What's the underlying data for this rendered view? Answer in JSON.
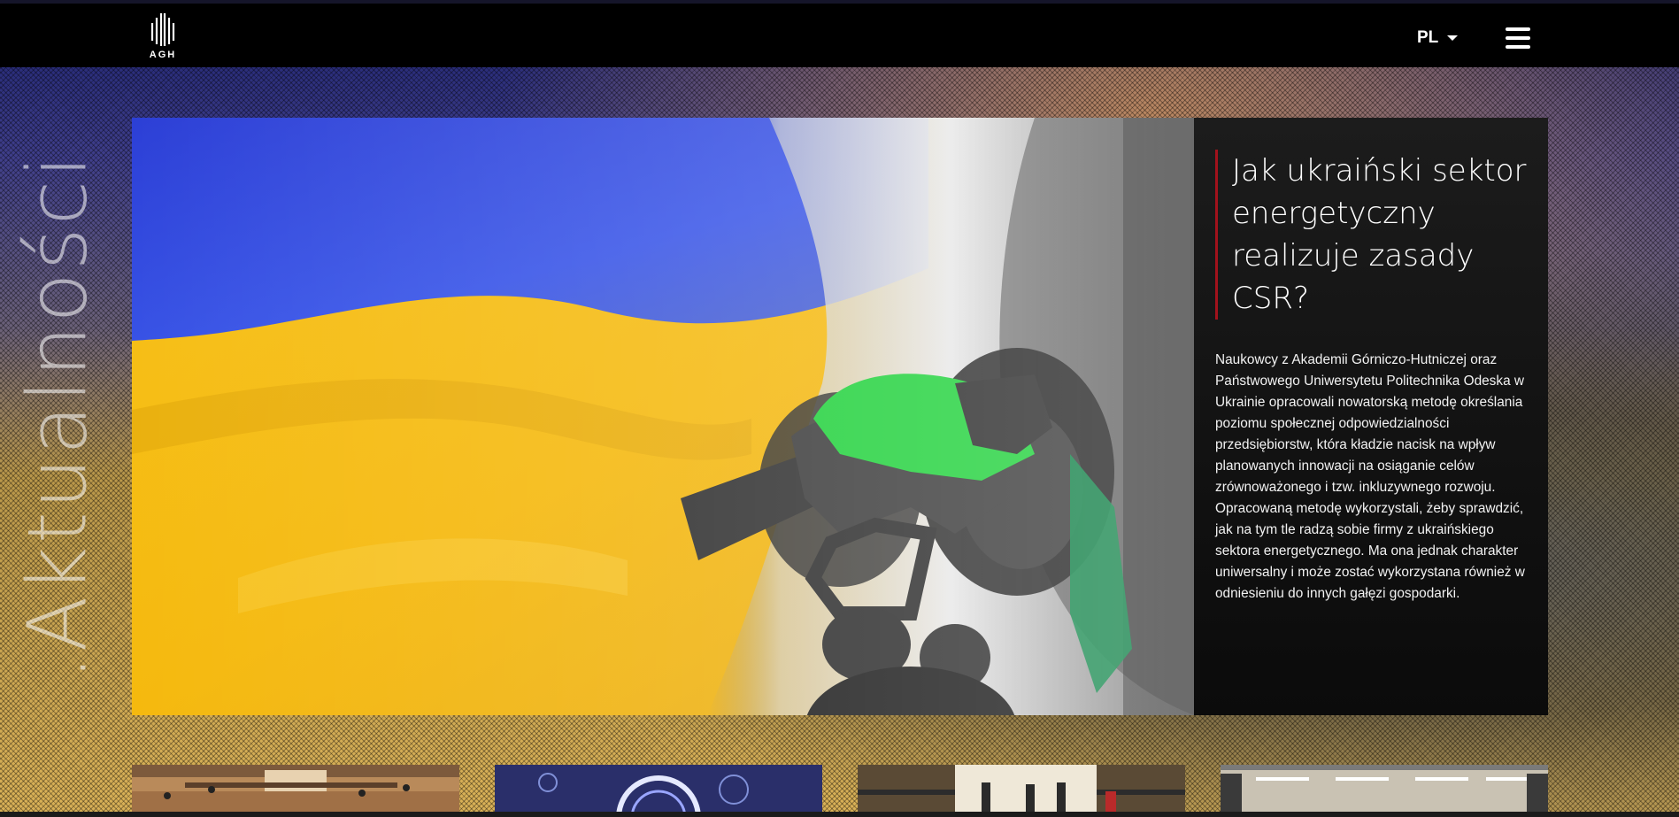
{
  "header": {
    "logo_text": "AGH",
    "language": "PL",
    "menu_icon": "hamburger-menu-icon"
  },
  "section": {
    "vertical_title": ".Aktualności"
  },
  "featured": {
    "title": "Jak ukraiński sektor energetyczny realizuje zasady CSR?",
    "description": "Naukowcy z Akademii Górniczo-Hutniczej oraz Państwowego Uniwersytetu Politechnika Odeska w Ukrainie opracowali nowatorską metodę określania poziomu społecznej odpowiedzialności przedsiębiorstw, która kładzie nacisk na wpływ planowanych innowacji na osiąganie celów zrównoważonego i tzw. inkluzywnego rozwoju. Opracowaną metodę wykorzystali, żeby sprawdzić, jak na tym tle radzą sobie firmy z ukraińskiego sektora energetycznego. Ma ona jednak charakter uniwersalny i może zostać wykorzystana również w odniesieniu do innych gałęzi gospodarki.",
    "accent_color": "#a2121c"
  },
  "news_thumbnails": [
    {
      "icon": "graduation-hall-image"
    },
    {
      "icon": "technology-hud-image"
    },
    {
      "icon": "ceremony-hall-image"
    },
    {
      "icon": "lecture-room-image"
    }
  ]
}
